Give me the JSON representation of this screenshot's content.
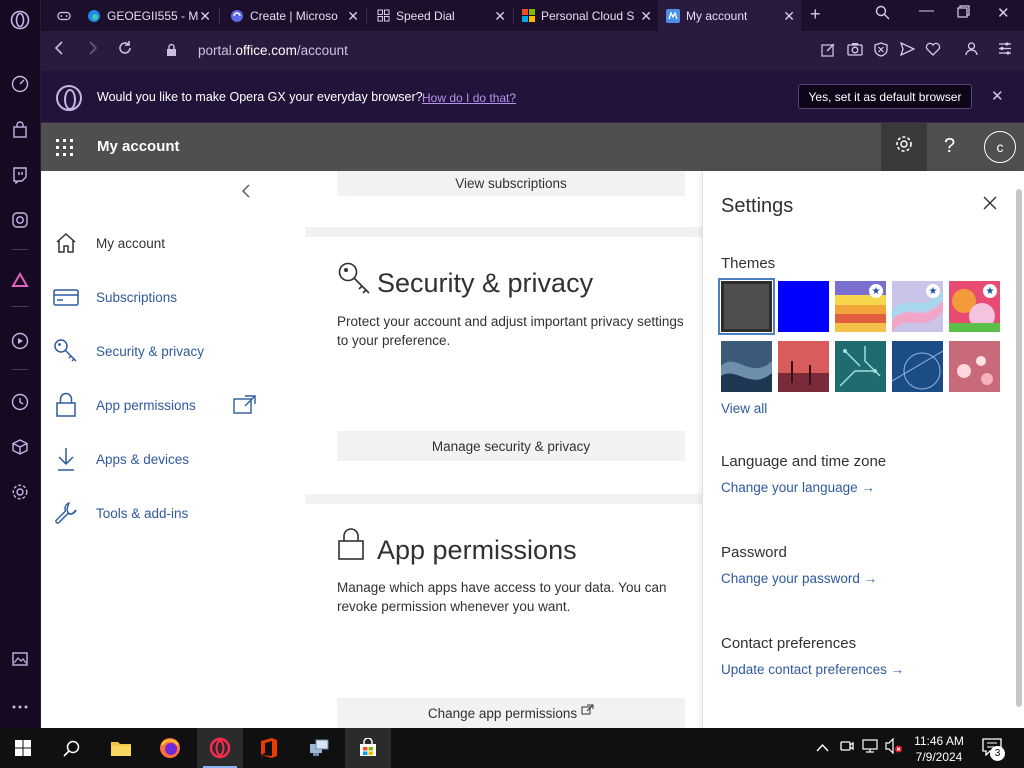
{
  "browser": {
    "tabs": [
      {
        "title": "GEOEGII555 - M"
      },
      {
        "title": "Create | Microso"
      },
      {
        "title": "Speed Dial"
      },
      {
        "title": "Personal Cloud S"
      },
      {
        "title": "My account"
      }
    ],
    "url_prefix": "portal.",
    "url_domain": "office.com",
    "url_path": "/account"
  },
  "default_bar": {
    "question": "Would you like to make Opera GX your everyday browser?",
    "how_link": "How do I do that?",
    "yes_button": "Yes, set it as default browser"
  },
  "office_header": {
    "title": "My account",
    "avatar_letter": "c",
    "help": "?"
  },
  "nav": {
    "items": [
      {
        "label": "My account",
        "icon": "home-icon"
      },
      {
        "label": "Subscriptions",
        "icon": "card-icon"
      },
      {
        "label": "Security & privacy",
        "icon": "key-icon"
      },
      {
        "label": "App permissions",
        "icon": "lock-icon"
      },
      {
        "label": "Apps & devices",
        "icon": "download-icon"
      },
      {
        "label": "Tools & add-ins",
        "icon": "wrench-icon"
      }
    ]
  },
  "main": {
    "view_subscriptions": "View subscriptions",
    "security": {
      "title": "Security & privacy",
      "desc": "Protect your account and adjust important privacy settings to your preference.",
      "button": "Manage security & privacy"
    },
    "permissions": {
      "title": "App permissions",
      "desc": "Manage which apps have access to your data. You can revoke permission whenever you want.",
      "button": "Change app permissions"
    }
  },
  "settings": {
    "title": "Settings",
    "themes_heading": "Themes",
    "view_all": "View all",
    "themes": [
      {
        "name": "dark-gray-theme",
        "color": "#4f4f4f",
        "star": false,
        "selected": true
      },
      {
        "name": "blue-theme",
        "color": "#0000ff",
        "star": false,
        "selected": false
      },
      {
        "name": "sunset-stripes-theme",
        "color": "#f2b531",
        "star": true,
        "selected": false
      },
      {
        "name": "rainbow-swirl-theme",
        "color": "#c9c4e8",
        "star": true,
        "selected": false
      },
      {
        "name": "pink-abstract-theme",
        "color": "#e94c73",
        "star": true,
        "selected": false
      },
      {
        "name": "ocean-wave-theme",
        "color": "#3b5a7a",
        "star": false,
        "selected": false
      },
      {
        "name": "palm-sunset-theme",
        "color": "#d95c5c",
        "star": false,
        "selected": false
      },
      {
        "name": "circuit-theme",
        "color": "#1f6b6f",
        "star": false,
        "selected": false
      },
      {
        "name": "blueprint-theme",
        "color": "#1c4c86",
        "star": false,
        "selected": false
      },
      {
        "name": "bokeh-theme",
        "color": "#c96a7a",
        "star": false,
        "selected": false
      }
    ],
    "language_heading": "Language and time zone",
    "language_link": "Change your language",
    "password_heading": "Password",
    "password_link": "Change your password",
    "contact_heading": "Contact preferences",
    "contact_link": "Update contact preferences"
  },
  "taskbar": {
    "time": "11:46 AM",
    "date": "7/9/2024",
    "notifications": "3"
  }
}
